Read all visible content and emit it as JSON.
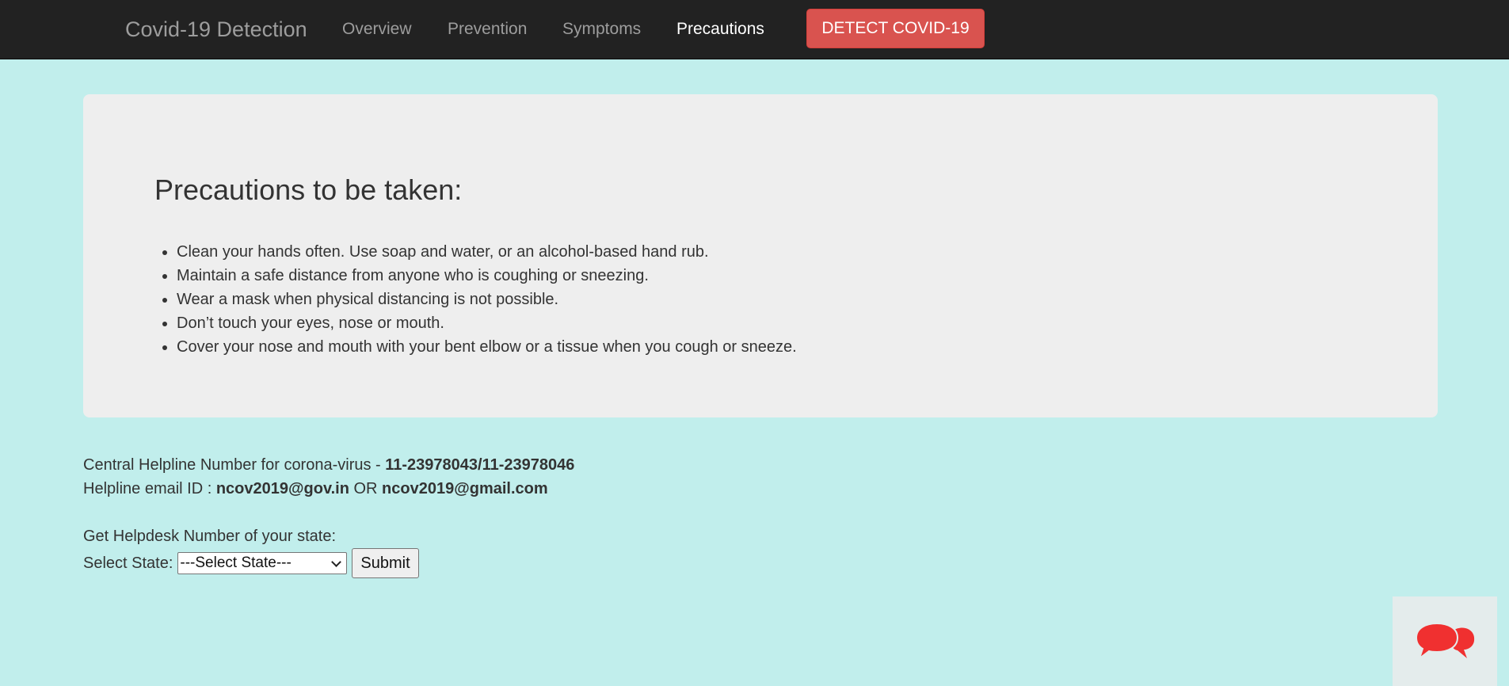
{
  "navbar": {
    "brand": "Covid-19 Detection",
    "links": [
      {
        "label": "Overview"
      },
      {
        "label": "Prevention"
      },
      {
        "label": "Symptoms"
      },
      {
        "label": "Precautions",
        "active": true
      }
    ],
    "detect_button": "DETECT COVID-19"
  },
  "jumbotron": {
    "title": "Precautions to be taken:",
    "items": [
      "Clean your hands often. Use soap and water, or an alcohol-based hand rub.",
      "Maintain a safe distance from anyone who is coughing or sneezing.",
      "Wear a mask when physical distancing is not possible.",
      "Don’t touch your eyes, nose or mouth.",
      "Cover your nose and mouth with your bent elbow or a tissue when you cough or sneeze."
    ]
  },
  "helpline": {
    "phone_label": "Central Helpline Number for corona-virus - ",
    "phone_number": "11-23978043/11-23978046",
    "email_label": "Helpline email ID : ",
    "email_primary": "ncov2019@gov.in",
    "email_separator": " OR ",
    "email_secondary": "ncov2019@gmail.com"
  },
  "state_form": {
    "heading": "Get Helpdesk Number of your state:",
    "select_label": "Select State: ",
    "select_value": "---Select State---",
    "submit_label": "Submit"
  },
  "chat_widget": {
    "icon": "chat-bubbles-icon",
    "color": "#f03030"
  },
  "colors": {
    "page_background": "#c1eeec",
    "navbar_background": "#222222",
    "danger_button": "#d9534f",
    "jumbotron_background": "#eeeeee"
  }
}
